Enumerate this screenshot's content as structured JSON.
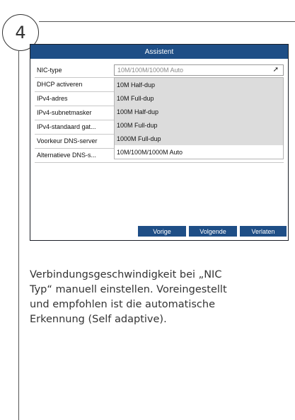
{
  "step": {
    "number": "4"
  },
  "dialog": {
    "title": "Assistent",
    "fields": [
      {
        "label": "NIC-type"
      },
      {
        "label": "DHCP activeren"
      },
      {
        "label": "IPv4-adres"
      },
      {
        "label": "IPv4-subnetmasker"
      },
      {
        "label": "IPv4-standaard gat..."
      },
      {
        "label": "Voorkeur DNS-server"
      },
      {
        "label": "Alternatieve DNS-s..."
      }
    ],
    "nic_select": {
      "value": "10M/100M/1000M Auto",
      "options": [
        "10M Half-dup",
        "10M Full-dup",
        "100M Half-dup",
        "100M Full-dup",
        "1000M Full-dup",
        "10M/100M/1000M Auto"
      ],
      "selected_option": "10M/100M/1000M Auto"
    },
    "buttons": {
      "previous": "Vorige",
      "next": "Volgende",
      "exit": "Verlaten"
    },
    "colors": {
      "title_bar": "#1e4e86",
      "button": "#1e4e86",
      "dropdown_bg": "#dcdcdc"
    }
  },
  "description": {
    "lines": [
      "Verbindungsgeschwindigkeit bei „NIC",
      "Typ“ manuell einstellen. Voreingestellt",
      "und empfohlen ist die automatische",
      "Erkennung (Self adaptive)."
    ]
  }
}
